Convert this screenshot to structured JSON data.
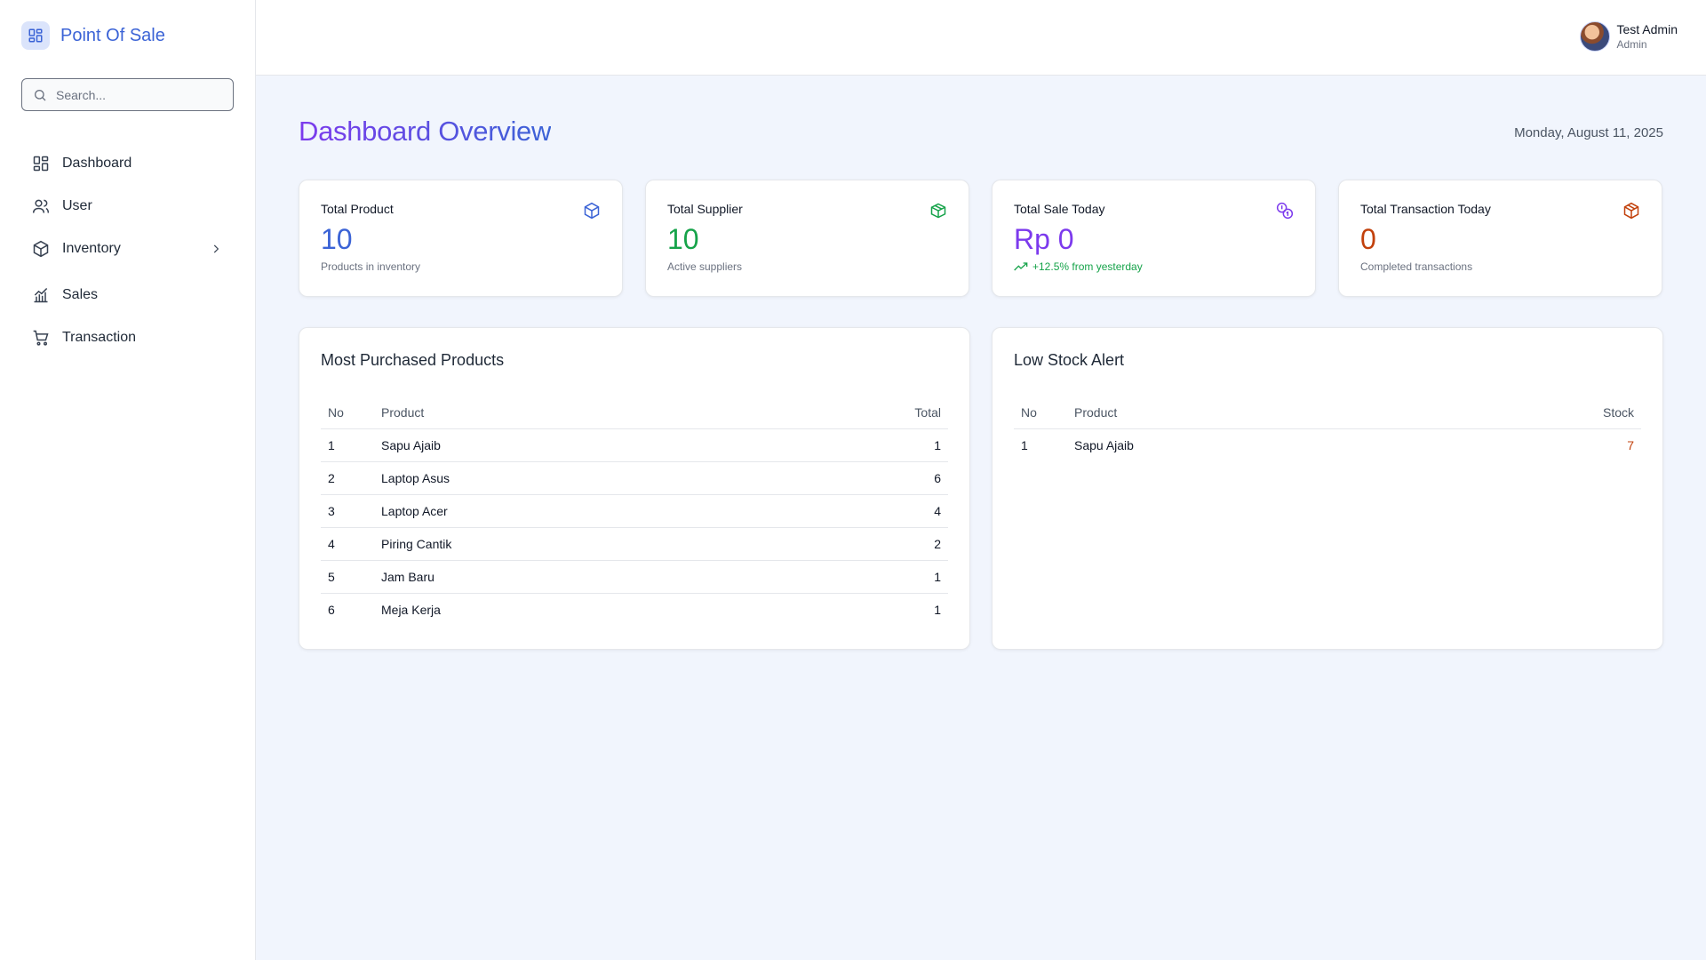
{
  "app": {
    "title": "Point Of Sale"
  },
  "search": {
    "placeholder": "Search..."
  },
  "sidebar": {
    "items": [
      {
        "label": "Dashboard",
        "icon": "dashboard-icon"
      },
      {
        "label": "User",
        "icon": "users-icon"
      },
      {
        "label": "Inventory",
        "icon": "box-icon",
        "has_submenu": true
      },
      {
        "label": "Sales",
        "icon": "chart-icon"
      },
      {
        "label": "Transaction",
        "icon": "cart-icon"
      }
    ]
  },
  "user": {
    "name": "Test Admin",
    "role": "Admin"
  },
  "page": {
    "title": "Dashboard Overview",
    "date": "Monday, August 11, 2025"
  },
  "stats": [
    {
      "label": "Total Product",
      "value": "10",
      "sub": "Products in inventory",
      "color": "#3b63d6",
      "icon": "cube-icon"
    },
    {
      "label": "Total Supplier",
      "value": "10",
      "sub": "Active suppliers",
      "color": "#16a34a",
      "icon": "package-icon"
    },
    {
      "label": "Total Sale Today",
      "value": "Rp 0",
      "sub": "+12.5% from yesterday",
      "color": "#7c3aed",
      "icon": "coins-icon"
    },
    {
      "label": "Total Transaction Today",
      "value": "0",
      "sub": "Completed transactions",
      "color": "#c2410c",
      "icon": "parcel-icon"
    }
  ],
  "most_purchased": {
    "title": "Most Purchased Products",
    "columns": [
      "No",
      "Product",
      "Total"
    ],
    "rows": [
      [
        "1",
        "Sapu Ajaib",
        "1"
      ],
      [
        "2",
        "Laptop Asus",
        "6"
      ],
      [
        "3",
        "Laptop Acer",
        "4"
      ],
      [
        "4",
        "Piring Cantik",
        "2"
      ],
      [
        "5",
        "Jam Baru",
        "1"
      ],
      [
        "6",
        "Meja Kerja",
        "1"
      ]
    ]
  },
  "low_stock": {
    "title": "Low Stock Alert",
    "columns": [
      "No",
      "Product",
      "Stock"
    ],
    "rows": [
      [
        "1",
        "Sapu Ajaib",
        "7"
      ]
    ]
  }
}
